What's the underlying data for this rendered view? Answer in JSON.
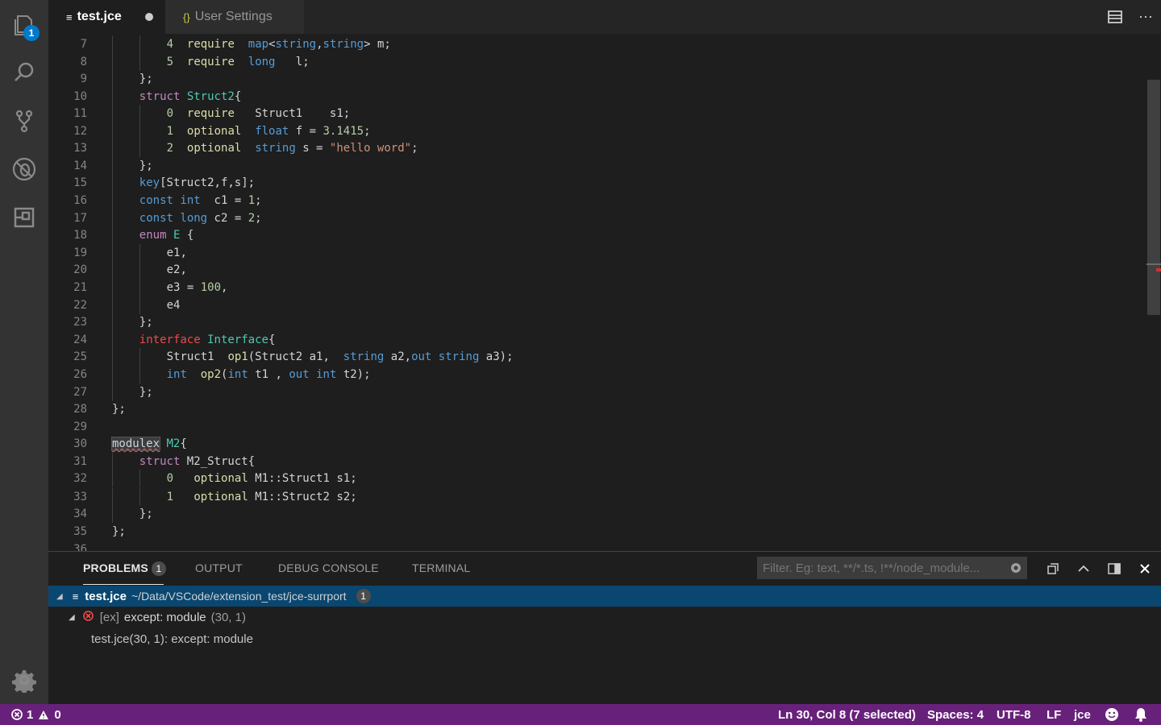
{
  "activity": {
    "explorer_badge": "1"
  },
  "tabs": [
    {
      "label": "test.jce",
      "icon": "≡",
      "dirty": true
    },
    {
      "label": "User Settings",
      "icon": "{}"
    }
  ],
  "editor": {
    "lines": [
      {
        "n": "7"
      },
      {
        "n": "8"
      },
      {
        "n": "9"
      },
      {
        "n": "10"
      },
      {
        "n": "11"
      },
      {
        "n": "12"
      },
      {
        "n": "13"
      },
      {
        "n": "14"
      },
      {
        "n": "15"
      },
      {
        "n": "16"
      },
      {
        "n": "17"
      },
      {
        "n": "18"
      },
      {
        "n": "19"
      },
      {
        "n": "20"
      },
      {
        "n": "21"
      },
      {
        "n": "22"
      },
      {
        "n": "23"
      },
      {
        "n": "24"
      },
      {
        "n": "25"
      },
      {
        "n": "26"
      },
      {
        "n": "27"
      },
      {
        "n": "28"
      },
      {
        "n": "29"
      },
      {
        "n": "30"
      },
      {
        "n": "31"
      },
      {
        "n": "32"
      },
      {
        "n": "33"
      },
      {
        "n": "34"
      },
      {
        "n": "35"
      },
      {
        "n": "36"
      }
    ],
    "code": [
      [
        [
          "4",
          "nm"
        ],
        [
          "  "
        ],
        [
          "require",
          "rq"
        ],
        [
          "  "
        ],
        [
          "map",
          "k1"
        ],
        [
          "<"
        ],
        [
          "string",
          "k1"
        ],
        [
          ","
        ],
        [
          "string",
          "k1"
        ],
        [
          "> m;"
        ]
      ],
      [
        [
          "5",
          "nm"
        ],
        [
          "  "
        ],
        [
          "require",
          "rq"
        ],
        [
          "  "
        ],
        [
          "long",
          "k1"
        ],
        [
          "   l;"
        ]
      ],
      [
        [
          "};"
        ]
      ],
      [
        [
          "struct",
          "k2"
        ],
        [
          " "
        ],
        [
          "Struct2",
          "ty"
        ],
        [
          "{"
        ]
      ],
      [
        [
          "0",
          "nm"
        ],
        [
          "  "
        ],
        [
          "require",
          "rq"
        ],
        [
          "   Struct1    s1;"
        ]
      ],
      [
        [
          "1",
          "nm"
        ],
        [
          "  "
        ],
        [
          "optional",
          "rq"
        ],
        [
          "  "
        ],
        [
          "float",
          "k1"
        ],
        [
          " f = "
        ],
        [
          "3.1415",
          "nm"
        ],
        [
          ";"
        ]
      ],
      [
        [
          "2",
          "nm"
        ],
        [
          "  "
        ],
        [
          "optional",
          "rq"
        ],
        [
          "  "
        ],
        [
          "string",
          "k1"
        ],
        [
          " s = "
        ],
        [
          "\"hello word\"",
          "st"
        ],
        [
          ";"
        ]
      ],
      [
        [
          "};"
        ]
      ],
      [
        [
          "key",
          "k1"
        ],
        [
          "[Struct2,f,s];"
        ]
      ],
      [
        [
          "const",
          "k1"
        ],
        [
          " "
        ],
        [
          "int",
          "k1"
        ],
        [
          "  c1 = "
        ],
        [
          "1",
          "nm"
        ],
        [
          ";"
        ]
      ],
      [
        [
          "const",
          "k1"
        ],
        [
          " "
        ],
        [
          "long",
          "k1"
        ],
        [
          " c2 = "
        ],
        [
          "2",
          "nm"
        ],
        [
          ";"
        ]
      ],
      [
        [
          "enum",
          "k2"
        ],
        [
          " "
        ],
        [
          "E",
          "ty"
        ],
        [
          " {"
        ]
      ],
      [
        [
          "e1,"
        ]
      ],
      [
        [
          "e2,"
        ]
      ],
      [
        [
          "e3 = "
        ],
        [
          "100",
          "nm"
        ],
        [
          ","
        ]
      ],
      [
        [
          "e4"
        ]
      ],
      [
        [
          "};"
        ]
      ],
      [
        [
          "interface",
          "k3"
        ],
        [
          " "
        ],
        [
          "Interface",
          "ty"
        ],
        [
          "{"
        ]
      ],
      [
        [
          "Struct1  "
        ],
        [
          "op1",
          "fn"
        ],
        [
          "(Struct2 a1,  "
        ],
        [
          "string",
          "k1"
        ],
        [
          " a2,"
        ],
        [
          "out",
          "k1"
        ],
        [
          " "
        ],
        [
          "string",
          "k1"
        ],
        [
          " a3);"
        ]
      ],
      [
        [
          "int",
          "k1"
        ],
        [
          "  "
        ],
        [
          "op2",
          "fn"
        ],
        [
          "("
        ],
        [
          "int",
          "k1"
        ],
        [
          " t1 , "
        ],
        [
          "out",
          "k1"
        ],
        [
          " "
        ],
        [
          "int",
          "k1"
        ],
        [
          " t2);"
        ]
      ],
      [
        [
          "};"
        ]
      ],
      [
        [
          "};"
        ]
      ],
      [],
      [
        [
          "modulex",
          "sel squig"
        ],
        [
          " "
        ],
        [
          "M2",
          "ty"
        ],
        [
          "{"
        ]
      ],
      [
        [
          "struct",
          "k2"
        ],
        [
          " M2_Struct{"
        ]
      ],
      [
        [
          "0",
          "nm"
        ],
        [
          "   "
        ],
        [
          "optional",
          "rq"
        ],
        [
          " M1::Struct1 s1;"
        ]
      ],
      [
        [
          "1",
          "nm"
        ],
        [
          "   "
        ],
        [
          "optional",
          "rq"
        ],
        [
          " M1::Struct2 s2;"
        ]
      ],
      [
        [
          "};"
        ]
      ],
      [
        [
          "};"
        ]
      ],
      []
    ]
  },
  "panel": {
    "tabs": [
      "PROBLEMS",
      "OUTPUT",
      "DEBUG CONSOLE",
      "TERMINAL"
    ],
    "problems_count": "1",
    "filter_placeholder": "Filter. Eg: text, **/*.ts, !**/node_module...",
    "file_row": {
      "name": "test.jce",
      "path": "~/Data/VSCode/extension_test/jce-surrport",
      "count": "1"
    },
    "problem": {
      "source": "[ex]",
      "message": "except: module",
      "location": "(30, 1)"
    },
    "detail": "test.jce(30, 1): except: module"
  },
  "status": {
    "errors": "1",
    "warnings": "0",
    "position": "Ln 30, Col 8 (7 selected)",
    "spaces": "Spaces: 4",
    "encoding": "UTF-8",
    "eol": "LF",
    "language": "jce"
  }
}
